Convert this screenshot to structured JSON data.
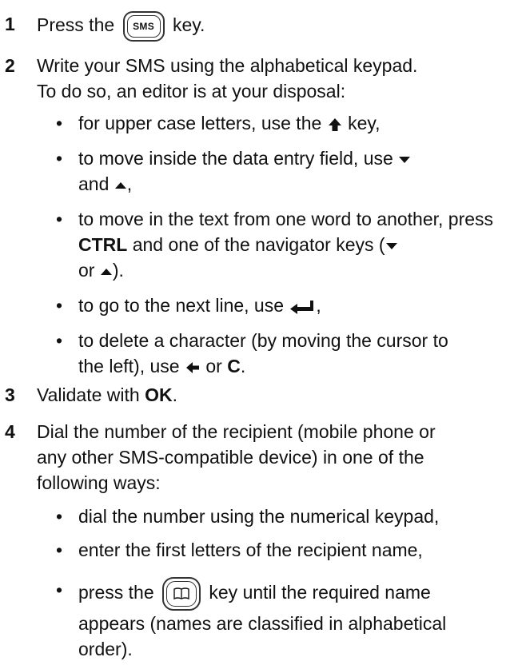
{
  "steps": [
    {
      "num": "1",
      "pre": "Press the",
      "key_label": "SMS",
      "post": "key."
    },
    {
      "num": "2",
      "line1": "Write your SMS using the alphabetical keypad.",
      "line2": "To do so, an editor is at your disposal:",
      "b1": {
        "pre": "for upper case letters, use the",
        "post": "key,"
      },
      "b2": {
        "pre": "to move inside the data entry field, use",
        "mid": "and",
        "post": ","
      },
      "b3": {
        "pre": "to move in the text from one word to another, press",
        "bold": "CTRL",
        "mid": "and one of the navigator keys (",
        "or": "or",
        "post": ")."
      },
      "b4": {
        "pre": "to go to the next line, use",
        "post": ","
      },
      "b5": {
        "line1": "to delete a character (by moving the cursor to",
        "pre": "the left), use",
        "or": "or",
        "bold": "C",
        "post": "."
      }
    },
    {
      "num": "3",
      "pre": "Validate with",
      "bold": "OK",
      "post": "."
    },
    {
      "num": "4",
      "line1": "Dial the number of the recipient (mobile phone or",
      "line2": "any other SMS-compatible device) in one of the",
      "line3": "following ways:",
      "b1": "dial the number using the numerical keypad,",
      "b2": "enter the first letters of the recipient name,",
      "b3": {
        "pre": "press the",
        "post": "key until the required name",
        "line2": "appears (names are classified in alphabetical",
        "line3": "order)."
      }
    }
  ]
}
